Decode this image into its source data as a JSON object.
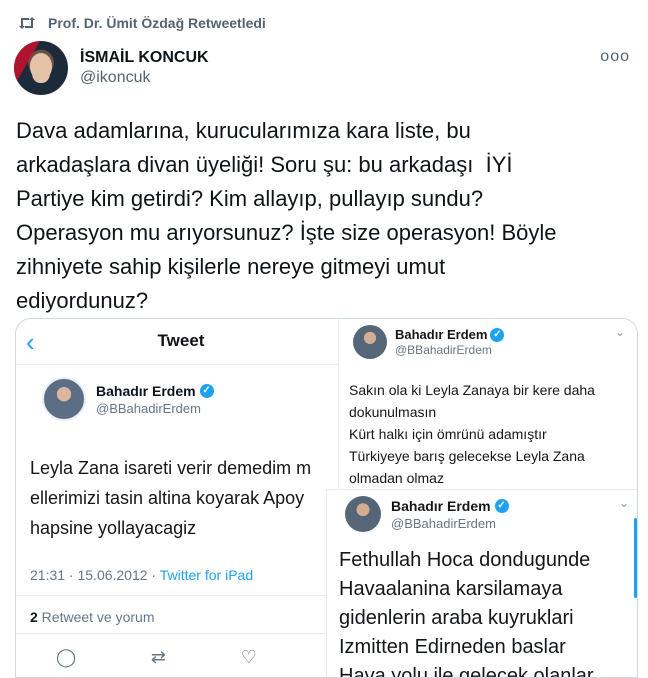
{
  "retweet": {
    "label": "Prof. Dr. Ümit Özdağ Retweetledi",
    "icon": "retweet-icon"
  },
  "author": {
    "name": "İSMAİL KONCUK",
    "handle": "@ikoncuk"
  },
  "more": {
    "label": "ooo"
  },
  "tweet": {
    "text": "Dava adamlarına, kurucularımıza kara liste, bu\narkadaşlara divan üyeliği! Soru şu: bu arkadaşı  İYİ\nPartiye kim getirdi? Kim allayıp, pullayıp sundu?\nOperasyon mu arıyorsunuz? İşte size operasyon! Böyle\nzihniyete sahip kişilerle nereye gitmeyi umut\nediyordunuz?"
  },
  "screenshot_left": {
    "title": "Tweet",
    "author_name": "Bahadır Erdem",
    "author_handle": "@BBahadirErdem",
    "lines": [
      "Leyla Zana isareti verir demedim m",
      "ellerimizi tasin altina koyarak Apoy",
      "hapsine yollayacagiz"
    ],
    "time": "21:31 · 15.06.2012 · ",
    "source": "Twitter for iPad",
    "retweet_count": "2",
    "retweet_label": " Retweet ve yorum"
  },
  "screenshot_right_top": {
    "author_name": "Bahadır Erdem",
    "author_handle": "@BBahadirErdem",
    "lines": [
      "Sakın ola ki Leyla Zanaya bir kere daha",
      "dokunulmasın",
      "Kürt halkı için ömrünü adamıştır",
      "Türkiyeye barış gelecekse Leyla Zana",
      "olmadan olmaz"
    ]
  },
  "screenshot_right_bottom": {
    "author_name": "Bahadır Erdem",
    "author_handle": "@BBahadirErdem",
    "lines": [
      "Fethullah Hoca dondugunde",
      "Havaalanina karsilamaya",
      "gidenlerin araba kuyruklari",
      "Izmitten Edirneden baslar",
      "Hava yolu ile gelecek olanlar"
    ]
  },
  "colors": {
    "accent": "#1da1f2",
    "muted": "#536471",
    "text": "#0f1419"
  }
}
